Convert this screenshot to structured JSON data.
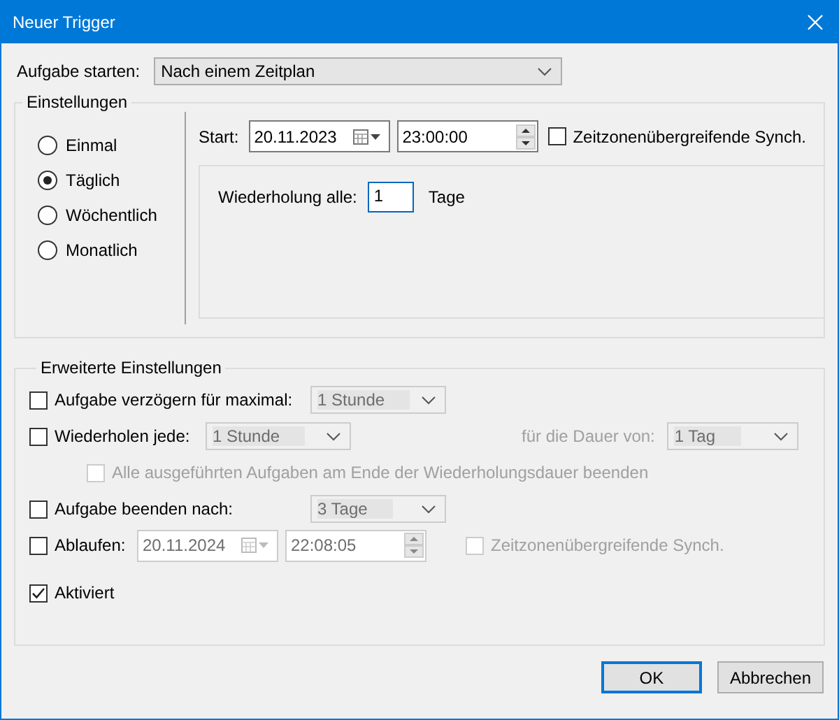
{
  "window": {
    "title": "Neuer Trigger"
  },
  "start_task": {
    "label": "Aufgabe starten:",
    "value": "Nach einem Zeitplan"
  },
  "settings": {
    "title": "Einstellungen",
    "schedule_options": [
      {
        "label": "Einmal",
        "selected": false
      },
      {
        "label": "Täglich",
        "selected": true
      },
      {
        "label": "Wöchentlich",
        "selected": false
      },
      {
        "label": "Monatlich",
        "selected": false
      }
    ],
    "start": {
      "label": "Start:",
      "date": "20.11.2023",
      "time": "23:00:00",
      "sync": {
        "label": "Zeitzonenübergreifende Synch.",
        "checked": false,
        "disabled": false
      }
    },
    "recurrence": {
      "label": "Wiederholung alle:",
      "value": "1",
      "unit": "Tage"
    }
  },
  "advanced": {
    "title": "Erweiterte Einstellungen",
    "delay": {
      "label": "Aufgabe verzögern für maximal:",
      "checked": false,
      "value": "1 Stunde",
      "disabled": true
    },
    "repeat": {
      "label": "Wiederholen jede:",
      "checked": false,
      "value": "1 Stunde",
      "disabled": true,
      "duration_label": "für die Dauer von:",
      "duration_value": "1 Tag",
      "stop_all": {
        "label": "Alle ausgeführten Aufgaben am Ende der Wiederholungsdauer beenden",
        "checked": false,
        "disabled": true
      }
    },
    "stop_after": {
      "label": "Aufgabe beenden nach:",
      "checked": false,
      "value": "3 Tage",
      "disabled": true
    },
    "expire": {
      "label": "Ablaufen:",
      "checked": false,
      "date": "20.11.2024",
      "time": "22:08:05",
      "disabled": true,
      "sync": {
        "label": "Zeitzonenübergreifende Synch.",
        "checked": false,
        "disabled": true
      }
    },
    "enabled": {
      "label": "Aktiviert",
      "checked": true
    }
  },
  "buttons": [
    {
      "label": "OK",
      "default": true
    },
    {
      "label": "Abbrechen",
      "default": false
    }
  ]
}
